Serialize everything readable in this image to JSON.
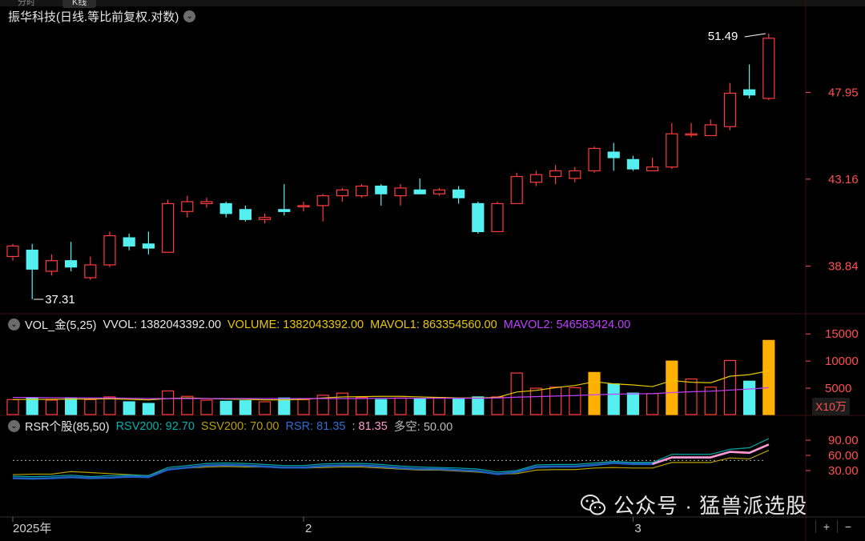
{
  "tabs": [
    "分时",
    "K线"
  ],
  "title": "振华科技(日线.等比前复权.对数)",
  "price_axis": {
    "ticks": [
      "47.95",
      "43.16",
      "38.84"
    ],
    "max_label": "51.49",
    "min_label": "37.31"
  },
  "vol_panel": {
    "name": "VOL_金(5,25)",
    "vvol": "VVOL: 1382043392.00",
    "volume": "VOLUME: 1382043392.00",
    "mavol1": "MAVOL1: 863354560.00",
    "mavol2": "MAVOL2: 546583424.00",
    "ticks": [
      "15000",
      "10000",
      "5000"
    ],
    "unit": "X10万"
  },
  "rsr_panel": {
    "name": "RSR个股(85,50)",
    "rsv200": "RSV200: 92.70",
    "ssv200": "SSV200: 70.00",
    "rsr": "RSR: 81.35",
    "pink": ": 81.35",
    "duokong": "多空: 50.00",
    "ticks": [
      "90.00",
      "60.00",
      "30.00"
    ]
  },
  "dates": [
    "2025年",
    "2",
    "3"
  ],
  "watermark": "公众号 · 猛兽派选股",
  "zoom": [
    "+",
    "−"
  ],
  "colors": {
    "up": "#ff3b3b",
    "down": "#54f0f0",
    "mavol1": "#e8c800",
    "mavol2": "#c040ff",
    "highlight": "#ffb000",
    "rsv": "#00a7a7",
    "ssv": "#b8a000",
    "rsr": "#1f5fbf",
    "pink": "#ff9ad0"
  },
  "chart_data": {
    "type": "candlestick",
    "candles": [
      {
        "o": 39.3,
        "c": 39.8,
        "h": 39.9,
        "l": 39.1
      },
      {
        "o": 39.6,
        "c": 38.7,
        "h": 39.9,
        "l": 37.31
      },
      {
        "o": 38.6,
        "c": 39.1,
        "h": 39.4,
        "l": 38.4
      },
      {
        "o": 39.1,
        "c": 38.8,
        "h": 40.0,
        "l": 38.6
      },
      {
        "o": 38.3,
        "c": 38.9,
        "h": 39.3,
        "l": 38.2
      },
      {
        "o": 38.9,
        "c": 40.3,
        "h": 40.5,
        "l": 38.8
      },
      {
        "o": 40.2,
        "c": 39.8,
        "h": 40.4,
        "l": 39.6
      },
      {
        "o": 39.9,
        "c": 39.7,
        "h": 40.5,
        "l": 39.4
      },
      {
        "o": 39.5,
        "c": 41.9,
        "h": 42.1,
        "l": 39.5
      },
      {
        "o": 41.5,
        "c": 42.0,
        "h": 42.3,
        "l": 41.2
      },
      {
        "o": 41.9,
        "c": 42.0,
        "h": 42.2,
        "l": 41.7
      },
      {
        "o": 41.9,
        "c": 41.4,
        "h": 42.0,
        "l": 41.2
      },
      {
        "o": 41.6,
        "c": 41.1,
        "h": 41.8,
        "l": 41.0
      },
      {
        "o": 41.1,
        "c": 41.2,
        "h": 41.4,
        "l": 40.9
      },
      {
        "o": 41.6,
        "c": 41.5,
        "h": 42.9,
        "l": 41.3
      },
      {
        "o": 41.8,
        "c": 41.8,
        "h": 42.0,
        "l": 41.5
      },
      {
        "o": 41.8,
        "c": 42.3,
        "h": 42.4,
        "l": 41.0
      },
      {
        "o": 42.3,
        "c": 42.6,
        "h": 42.7,
        "l": 42.0
      },
      {
        "o": 42.3,
        "c": 42.8,
        "h": 42.9,
        "l": 42.2
      },
      {
        "o": 42.8,
        "c": 42.4,
        "h": 42.9,
        "l": 41.8
      },
      {
        "o": 42.3,
        "c": 42.7,
        "h": 42.9,
        "l": 41.8
      },
      {
        "o": 42.6,
        "c": 42.4,
        "h": 43.2,
        "l": 42.4
      },
      {
        "o": 42.4,
        "c": 42.6,
        "h": 42.7,
        "l": 42.3
      },
      {
        "o": 42.6,
        "c": 42.2,
        "h": 42.8,
        "l": 41.9
      },
      {
        "o": 41.9,
        "c": 40.5,
        "h": 42.0,
        "l": 40.4
      },
      {
        "o": 40.5,
        "c": 41.9,
        "h": 42.0,
        "l": 40.5
      },
      {
        "o": 41.9,
        "c": 43.3,
        "h": 43.5,
        "l": 41.9
      },
      {
        "o": 43.0,
        "c": 43.4,
        "h": 43.6,
        "l": 42.8
      },
      {
        "o": 43.3,
        "c": 43.6,
        "h": 43.9,
        "l": 42.9
      },
      {
        "o": 43.2,
        "c": 43.6,
        "h": 43.8,
        "l": 43.0
      },
      {
        "o": 43.6,
        "c": 44.8,
        "h": 44.9,
        "l": 43.5
      },
      {
        "o": 44.6,
        "c": 44.3,
        "h": 45.1,
        "l": 43.6
      },
      {
        "o": 44.2,
        "c": 43.7,
        "h": 44.4,
        "l": 43.6
      },
      {
        "o": 43.6,
        "c": 43.8,
        "h": 44.3,
        "l": 43.6
      },
      {
        "o": 43.8,
        "c": 45.6,
        "h": 46.2,
        "l": 43.7
      },
      {
        "o": 45.6,
        "c": 45.6,
        "h": 46.2,
        "l": 45.4
      },
      {
        "o": 45.5,
        "c": 46.1,
        "h": 46.4,
        "l": 45.5
      },
      {
        "o": 46.0,
        "c": 47.9,
        "h": 48.5,
        "l": 45.8
      },
      {
        "o": 48.1,
        "c": 47.8,
        "h": 49.6,
        "l": 47.6
      },
      {
        "o": 47.6,
        "c": 51.2,
        "h": 51.49,
        "l": 47.5
      }
    ],
    "volume_x10k": [
      2900,
      3200,
      2800,
      3100,
      2900,
      3400,
      2500,
      2200,
      4500,
      3500,
      2800,
      2600,
      2700,
      2500,
      3200,
      2900,
      3700,
      4100,
      3300,
      2900,
      3200,
      3100,
      3300,
      3000,
      3400,
      3400,
      7800,
      5000,
      5200,
      5100,
      7900,
      5800,
      4100,
      4000,
      10000,
      6700,
      5200,
      10100,
      6300,
      13800
    ],
    "mavol1": [
      2900,
      2950,
      2950,
      3000,
      3000,
      3050,
      2950,
      2850,
      3100,
      3200,
      3100,
      3000,
      2950,
      2850,
      2850,
      2950,
      3200,
      3400,
      3450,
      3500,
      3500,
      3400,
      3300,
      3200,
      3200,
      3300,
      4300,
      4600,
      5100,
      5500,
      6200,
      5800,
      5600,
      5300,
      6400,
      6100,
      6000,
      7200,
      7500,
      8200
    ],
    "mavol2": [
      3300,
      3300,
      3250,
      3250,
      3200,
      3200,
      3150,
      3100,
      3100,
      3100,
      3100,
      3100,
      3100,
      3100,
      3100,
      3100,
      3100,
      3100,
      3100,
      3150,
      3150,
      3150,
      3150,
      3150,
      3150,
      3200,
      3350,
      3450,
      3550,
      3650,
      3800,
      3900,
      3950,
      4000,
      4200,
      4350,
      4450,
      4650,
      4850,
      5100
    ],
    "rsv200": [
      19,
      18,
      19,
      21,
      18,
      20,
      21,
      20,
      36,
      40,
      44,
      45,
      44,
      42,
      40,
      40,
      43,
      44,
      44,
      42,
      39,
      37,
      36,
      35,
      33,
      27,
      30,
      41,
      42,
      42,
      45,
      48,
      46,
      46,
      62,
      62,
      62,
      72,
      75,
      93
    ],
    "ssv200": [
      22,
      23,
      23,
      28,
      26,
      24,
      22,
      20,
      33,
      35,
      37,
      38,
      37,
      37,
      35,
      35,
      36,
      37,
      37,
      35,
      33,
      31,
      31,
      29,
      27,
      23,
      24,
      31,
      32,
      32,
      35,
      36,
      35,
      35,
      46,
      46,
      46,
      55,
      53,
      70
    ],
    "rsr": [
      15,
      14,
      15,
      17,
      15,
      16,
      18,
      17,
      32,
      36,
      40,
      41,
      40,
      38,
      36,
      36,
      39,
      40,
      40,
      38,
      35,
      33,
      33,
      31,
      29,
      23,
      27,
      37,
      38,
      38,
      41,
      45,
      43,
      43,
      56,
      56,
      56,
      67,
      65,
      81.35
    ],
    "duokong": 50
  }
}
